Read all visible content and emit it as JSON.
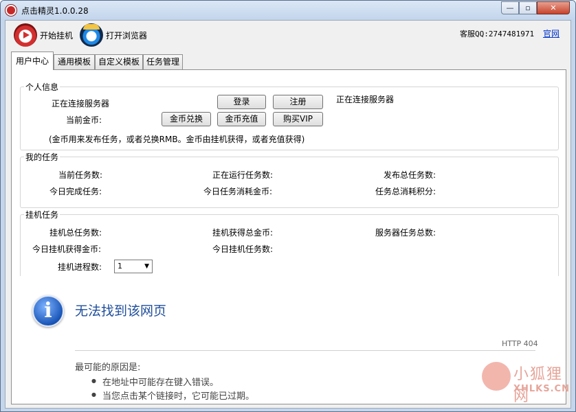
{
  "window": {
    "title": "点击精灵1.0.0.28"
  },
  "window_controls": {
    "minimize": "—",
    "maximize": "▫",
    "close": "✕"
  },
  "toolbar": {
    "start_label": "开始挂机",
    "browser_label": "打开浏览器",
    "support": "客服QQ:2747481971",
    "official_site": "官网"
  },
  "tabs": [
    "用户中心",
    "通用模板",
    "自定义模板",
    "任务管理"
  ],
  "personal": {
    "title": "个人信息",
    "status_left": "正在连接服务器",
    "status_right": "正在连接服务器",
    "gold_label": "当前金币:",
    "login": "登录",
    "register": "注册",
    "exchange": "金币兑换",
    "recharge": "金币充值",
    "vip": "购买VIP",
    "note": "(金币用来发布任务，或者兑换RMB。金币由挂机获得，或者充值获得)"
  },
  "my_tasks": {
    "title": "我的任务",
    "current": "当前任务数:",
    "running": "正在运行任务数:",
    "published": "发布总任务数:",
    "done_today": "今日完成任务:",
    "gold_today": "今日任务消耗金币:",
    "points_total": "任务总消耗积分:"
  },
  "hang_tasks": {
    "title": "挂机任务",
    "total": "挂机总任务数:",
    "gold_total": "挂机获得总金币:",
    "server_total": "服务器任务总数:",
    "gold_today": "今日挂机获得金币:",
    "tasks_today": "今日挂机任务数:",
    "process_label": "挂机进程数:",
    "process_value": "1"
  },
  "error_page": {
    "title": "无法找到该网页",
    "code": "HTTP 404",
    "reason": "最可能的原因是:",
    "items": [
      "在地址中可能存在键入错误。",
      "当您点击某个链接时，它可能已过期。"
    ]
  },
  "watermark": {
    "cn": "小狐狸网",
    "en": "XHLKS.CN"
  }
}
